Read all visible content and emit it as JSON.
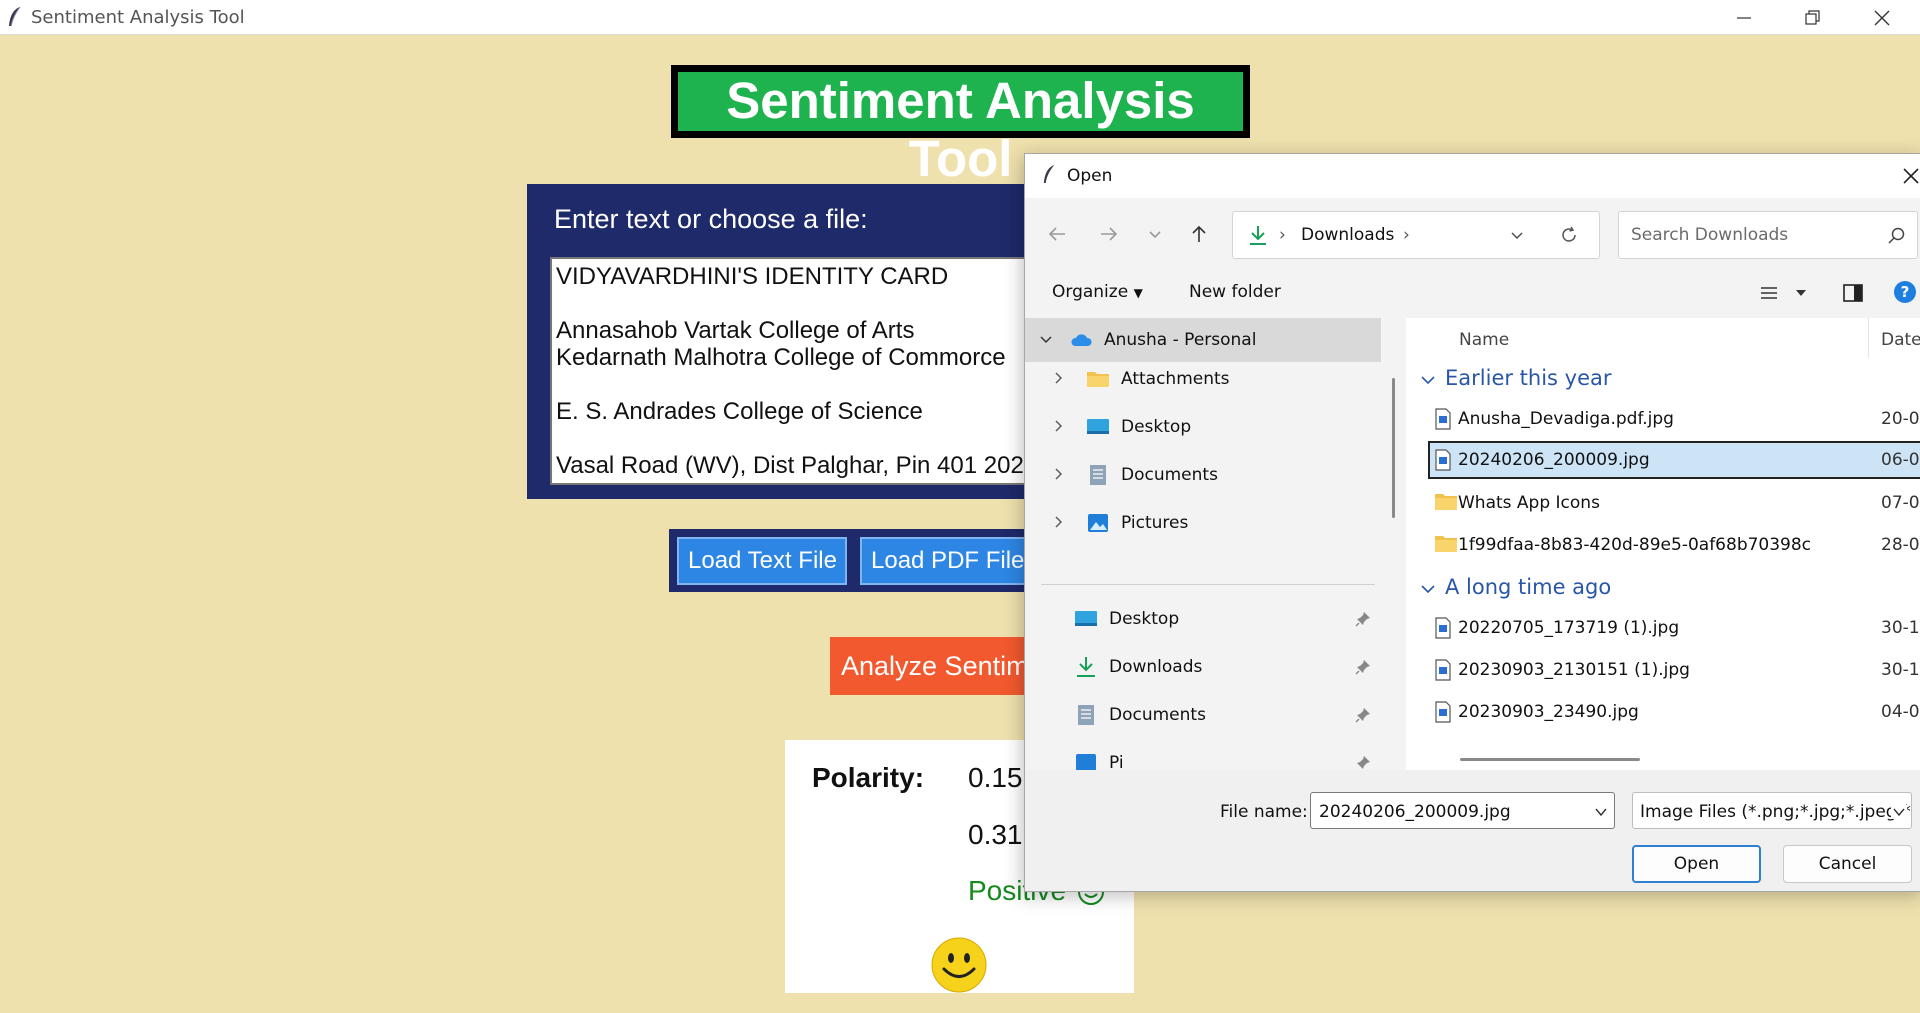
{
  "window": {
    "title": "Sentiment Analysis Tool"
  },
  "app": {
    "heading": "Sentiment Analysis Tool",
    "input_label": "Enter text or choose a file:",
    "text_content": "VIDYAVARDHINI'S IDENTITY CARD\n\nAnnasahob Vartak College of Arts\nKedarnath Malhotra College of Commorce\n\nE. S. Andrades College of Science\n\nVasal Road (WV), Dist Palghar, Pin 401 202",
    "load_text_button": "Load Text File",
    "load_pdf_button": "Load PDF File",
    "analyze_button": "Analyze Sentiment",
    "polarity_label": "Polarity:",
    "polarity_value": "0.15",
    "subjectivity_value": "0.31",
    "sentiment_label": "Positive",
    "colors": {
      "background": "#efe1ad",
      "heading_bg": "#1fb34f",
      "panel_bg": "#1e2a6a",
      "load_button": "#2e86e4",
      "analyze_button": "#f3592f",
      "positive": "#158a1e"
    }
  },
  "dialog": {
    "title": "Open",
    "breadcrumb": "Downloads",
    "search_placeholder": "Search Downloads",
    "organize": "Organize",
    "new_folder": "New folder",
    "tree": [
      {
        "label": "Anusha - Personal",
        "icon": "cloud-icon"
      },
      {
        "label": "Attachments",
        "icon": "folder-icon"
      },
      {
        "label": "Desktop",
        "icon": "desktop-icon"
      },
      {
        "label": "Documents",
        "icon": "documents-icon"
      },
      {
        "label": "Pictures",
        "icon": "pictures-icon"
      }
    ],
    "quick_access": [
      {
        "label": "Desktop",
        "icon": "desktop-icon"
      },
      {
        "label": "Downloads",
        "icon": "download-icon"
      },
      {
        "label": "Documents",
        "icon": "documents-icon"
      },
      {
        "label": "Pi",
        "icon": "pictures-icon"
      }
    ],
    "columns": {
      "name": "Name",
      "date": "Date"
    },
    "groups": [
      {
        "label": "Earlier this year",
        "files": [
          {
            "name": "Anusha_Devadiga.pdf.jpg",
            "date": "20-0",
            "icon": "image-file-icon",
            "selected": false
          },
          {
            "name": "20240206_200009.jpg",
            "date": "06-0",
            "icon": "image-file-icon",
            "selected": true
          },
          {
            "name": "Whats App Icons",
            "date": "07-0",
            "icon": "folder-icon",
            "selected": false
          },
          {
            "name": "1f99dfaa-8b83-420d-89e5-0af68b70398c",
            "date": "28-0",
            "icon": "folder-icon",
            "selected": false
          }
        ]
      },
      {
        "label": "A long time ago",
        "files": [
          {
            "name": "20220705_173719 (1).jpg",
            "date": "30-1",
            "icon": "image-file-icon",
            "selected": false
          },
          {
            "name": "20230903_2130151 (1).jpg",
            "date": "30-1",
            "icon": "image-file-icon",
            "selected": false
          },
          {
            "name": "20230903_23490.jpg",
            "date": "04-0",
            "icon": "image-file-icon",
            "selected": false
          }
        ]
      }
    ],
    "file_name_label": "File name:",
    "file_name_value": "20240206_200009.jpg",
    "file_type_filter": "Image Files (*.png;*.jpg;*.jpeg;*",
    "open_button": "Open",
    "cancel_button": "Cancel"
  }
}
